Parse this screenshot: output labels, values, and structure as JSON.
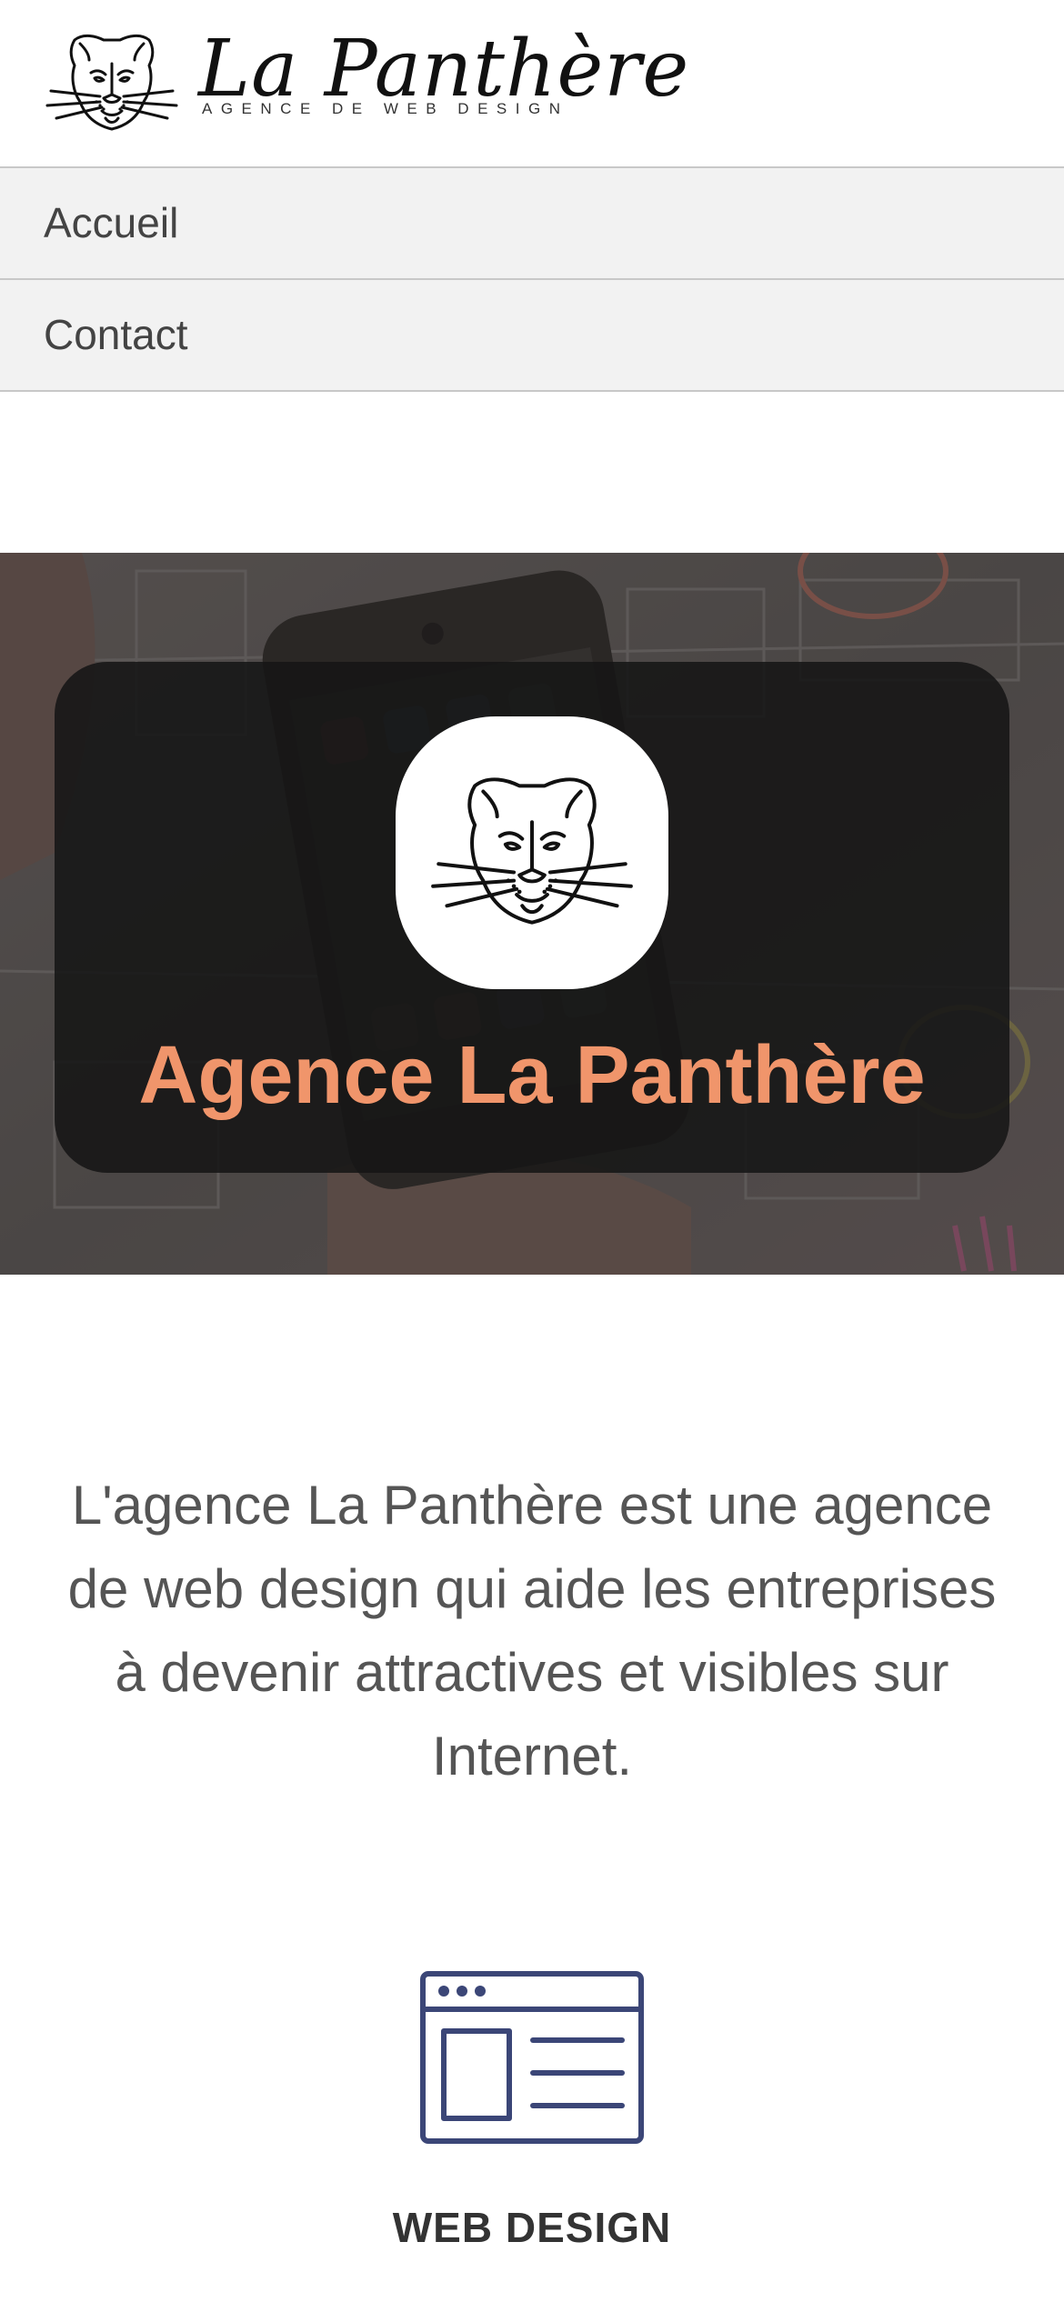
{
  "brand": {
    "name": "La Panthère",
    "tagline": "AGENCE DE WEB DESIGN",
    "logo_icon": "panther-head-icon"
  },
  "nav": {
    "items": [
      {
        "label": "Accueil"
      },
      {
        "label": "Contact"
      }
    ]
  },
  "hero": {
    "title": "Agence La Panthère",
    "background": "photo of smartphone wireframe sketches on paper",
    "logo_icon": "panther-head-icon",
    "title_color": "#f0956b"
  },
  "intro": {
    "text": "L'agence La Panthère est une agence de web design qui aide les entreprises à devenir attractives et visibles sur Internet."
  },
  "service": {
    "icon": "web-layout-icon",
    "title": "WEB DESIGN",
    "icon_color": "#3b4677"
  }
}
